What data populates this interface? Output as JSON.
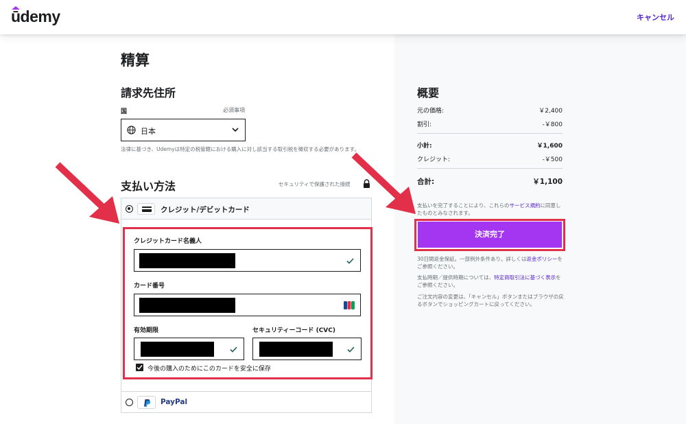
{
  "header": {
    "logo": "ūdemy",
    "cancel": "キャンセル"
  },
  "checkout": {
    "title": "精算"
  },
  "billing": {
    "title": "請求先住所",
    "country_label": "国",
    "required": "必須事項",
    "country_value": "日本",
    "tax_note": "法律に基づき、Udemyは特定の税管轄における購入に対し該当する取引税を徴収する必要があります。"
  },
  "payment": {
    "title": "支払い方法",
    "secure": "セキュリティで保護された接続",
    "card_option": "クレジット/デビットカード",
    "name_label": "クレジットカード名義人",
    "number_label": "カード番号",
    "expiry_label": "有効期限",
    "cvc_label": "セキュリティーコード (CVC)",
    "save_label": "今後の購入のためにこのカードを安全に保存",
    "save_checked": true,
    "paypal_option": "PayPal"
  },
  "summary": {
    "title": "概要",
    "original_label": "元の価格:",
    "original_value": "￥2,400",
    "discount_label": "割引:",
    "discount_value": "-￥800",
    "subtotal_label": "小計:",
    "subtotal_value": "￥1,600",
    "credit_label": "クレジット:",
    "credit_value": "-￥500",
    "total_label": "合計:",
    "total_value": "￥1,100",
    "terms_before": "支払いを完了することにより、これらの",
    "terms_link": "サービス規約",
    "terms_after": "に同意したものとみなされます。",
    "button": "決済完了",
    "refund_before": "30日間返金保証。一部例外条件あり。詳しくは",
    "refund_link": "返金ポリシー",
    "refund_after": "をご参照ください。",
    "delivery_before": "支払時期／提供時期については、",
    "delivery_link": "特定商取引法に基づく表示",
    "delivery_after": "をご参照ください。",
    "change_note": "ご注文内容の変更は、「キャンセル」ボタンまたはブラウザの戻るボタンでショッピングカートに戻ってください。"
  },
  "colors": {
    "brand_purple": "#a435f0",
    "link_purple": "#5624d0",
    "highlight_red": "#e2304a",
    "success_green": "#1e6055"
  }
}
